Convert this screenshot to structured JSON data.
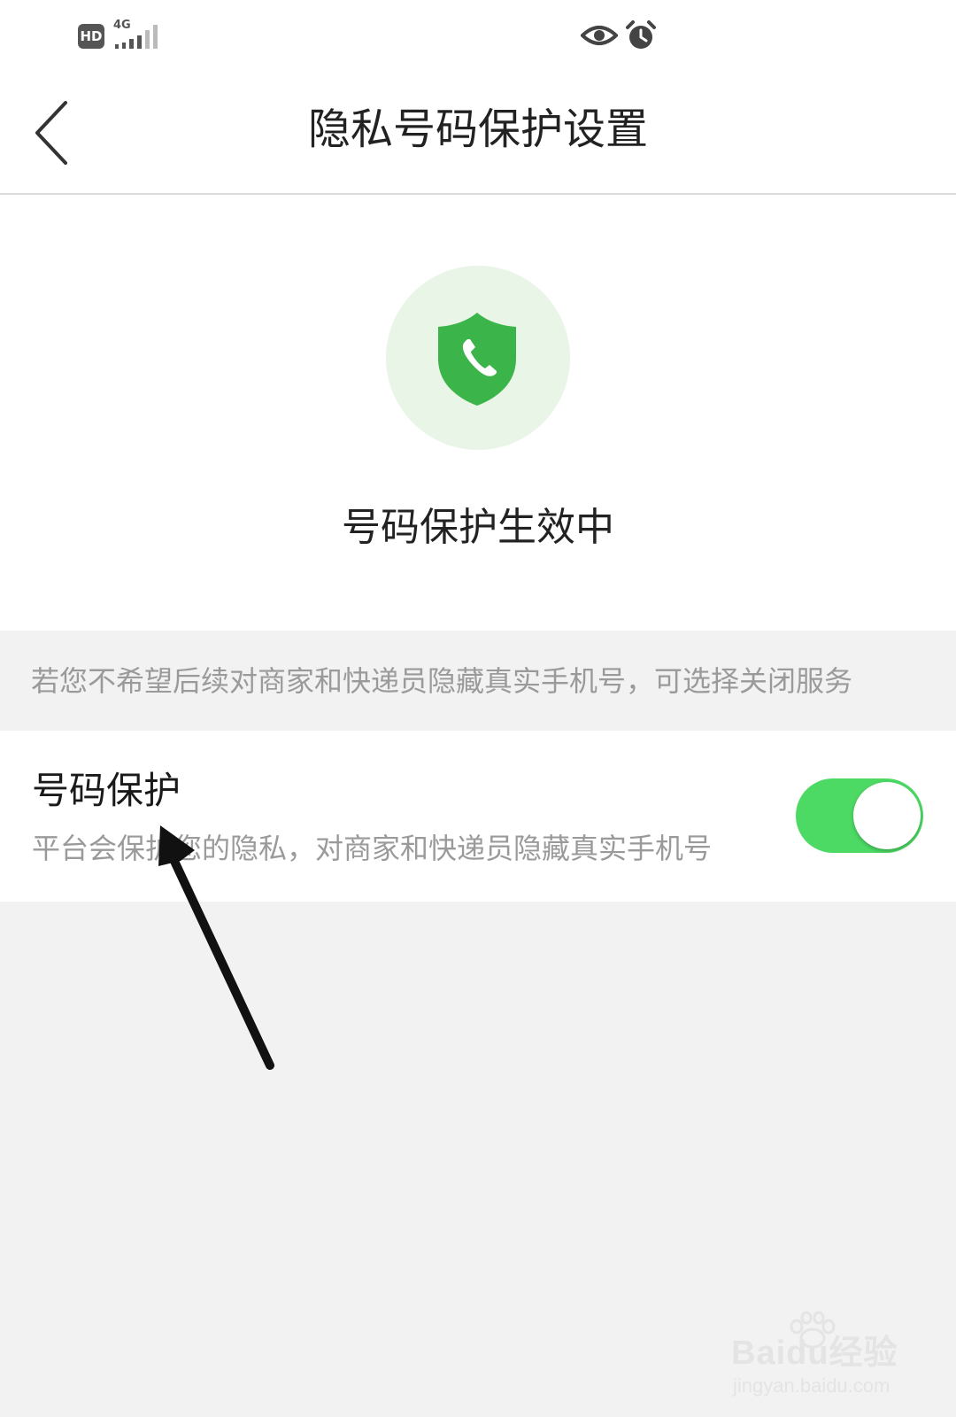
{
  "status_bar": {
    "hd_badge": "HD",
    "network_label": "4G",
    "signal_level": 0.5,
    "icons": [
      "hd-icon",
      "signal-icon",
      "eye-icon",
      "alarm-clock-icon"
    ]
  },
  "navbar": {
    "back_icon": "chevron-left-icon",
    "title": "隐私号码保护设置"
  },
  "hero": {
    "icon": "shield-phone-icon",
    "status": "号码保护生效中"
  },
  "hint": {
    "text": "若您不希望后续对商家和快递员隐藏真实手机号，可选择关闭服务"
  },
  "setting": {
    "title": "号码保护",
    "description": "平台会保护您的隐私，对商家和快递员隐藏真实手机号",
    "toggle_on": true
  },
  "annotation": {
    "icon": "arrow-annotation"
  },
  "watermark": {
    "brand": "Baidu经验",
    "url": "jingyan.baidu.com"
  },
  "colors": {
    "accent_green": "#4cd964",
    "shield_green": "#3bb54a",
    "shield_bg": "#e9f5e7",
    "page_bg": "#f2f2f2"
  }
}
